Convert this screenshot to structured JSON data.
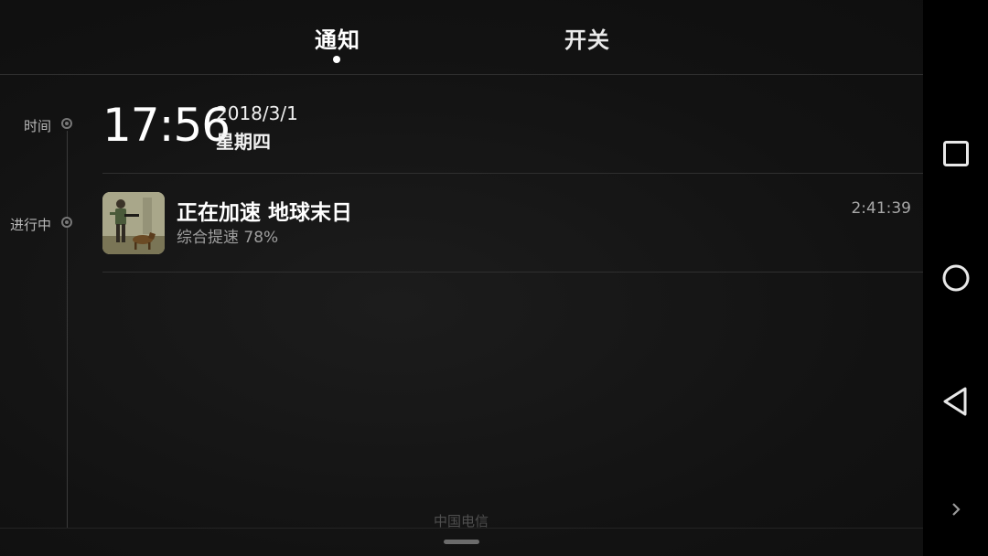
{
  "tabs": [
    {
      "label": "通知",
      "active": true
    },
    {
      "label": "开关",
      "active": false
    }
  ],
  "timeline": {
    "time_label": "时间",
    "ongoing_label": "进行中"
  },
  "clock": {
    "time": "17:56",
    "date": "2018/3/1",
    "weekday": "星期四"
  },
  "notification": {
    "title": "正在加速 地球末日",
    "subtitle": "综合提速 78%",
    "elapsed": "2:41:39",
    "app_icon": "game-app-icon"
  },
  "footer": {
    "carrier": "中国电信"
  },
  "navbar": {
    "buttons": [
      "recents-icon",
      "home-icon",
      "back-icon",
      "expand-icon"
    ]
  },
  "colors": {
    "background": "#141414",
    "navbar": "#000000",
    "text_primary": "#ffffff",
    "text_secondary": "#9e9e9e"
  }
}
